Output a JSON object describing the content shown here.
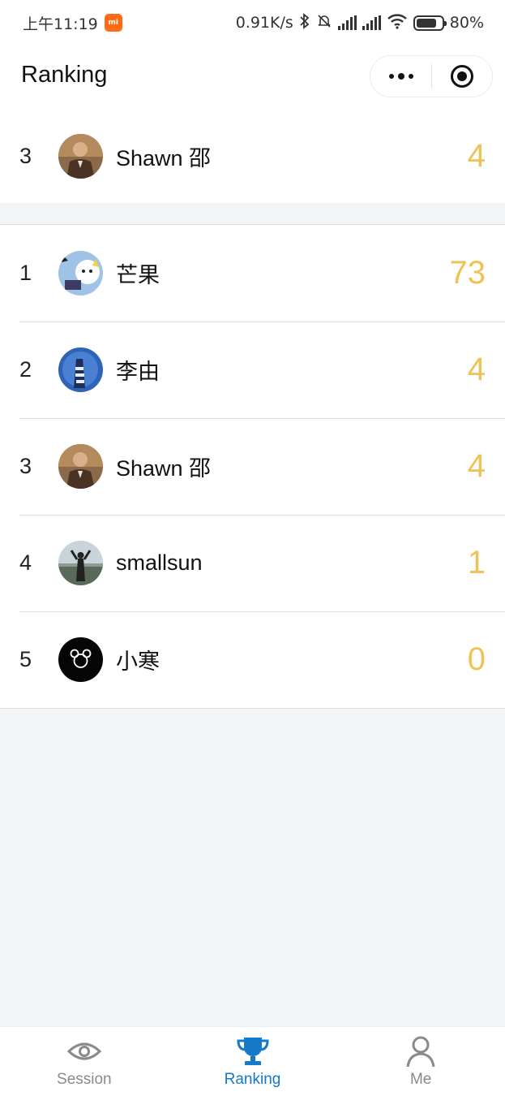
{
  "status_bar": {
    "time": "上午11:19",
    "net_speed": "0.91K/s",
    "battery": "80%"
  },
  "nav": {
    "title": "Ranking"
  },
  "my_rank": {
    "rank": "3",
    "name": "Shawn 邵",
    "score": "4"
  },
  "ranking": [
    {
      "rank": "1",
      "name": "芒果",
      "score": "73"
    },
    {
      "rank": "2",
      "name": "李由",
      "score": "4"
    },
    {
      "rank": "3",
      "name": "Shawn 邵",
      "score": "4"
    },
    {
      "rank": "4",
      "name": "smallsun",
      "score": "1"
    },
    {
      "rank": "5",
      "name": "小寒",
      "score": "0"
    }
  ],
  "tabs": [
    {
      "label": "Session",
      "icon": "eye-icon",
      "active": false
    },
    {
      "label": "Ranking",
      "icon": "trophy-icon",
      "active": true
    },
    {
      "label": "Me",
      "icon": "user-icon",
      "active": false
    }
  ],
  "colors": {
    "score": "#efc257",
    "active_tab": "#1479c8",
    "inactive_tab": "#8a8a8a"
  }
}
